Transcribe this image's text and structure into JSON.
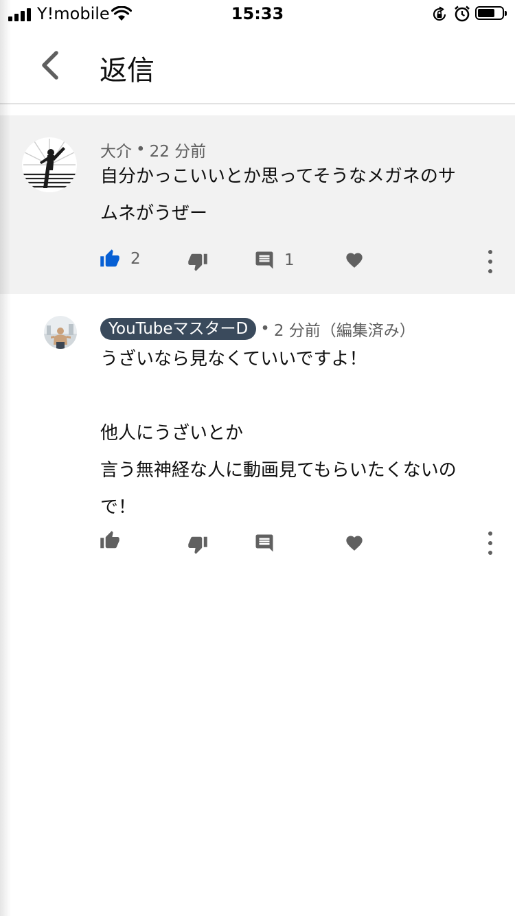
{
  "status_bar": {
    "carrier": "Y!mobile",
    "time": "15:33",
    "battery_icon": "battery-icon",
    "wifi_icon": "wifi-icon"
  },
  "header": {
    "title": "返信",
    "back_icon": "chevron-left-icon"
  },
  "colors": {
    "like_active": "#065fd4",
    "icon_gray": "#606060",
    "parent_bg": "#f2f2f2",
    "badge_bg": "#3a4a5c"
  },
  "parent_comment": {
    "author": "大介",
    "separator": "•",
    "time": "22 分前",
    "lines": [
      "自分かっこいいとか思ってそうなメガネのサ",
      "ムネがうぜー"
    ],
    "like_count": "2",
    "reply_count": "1",
    "liked": true
  },
  "reply_comment": {
    "author": "YouTubeマスターD",
    "separator": "•",
    "time": "2 分前（編集済み）",
    "lines": [
      "うざいなら見なくていいですよ！",
      "",
      "他人にうざいとか",
      "言う無神経な人に動画見てもらいたくないの",
      "で！"
    ]
  }
}
